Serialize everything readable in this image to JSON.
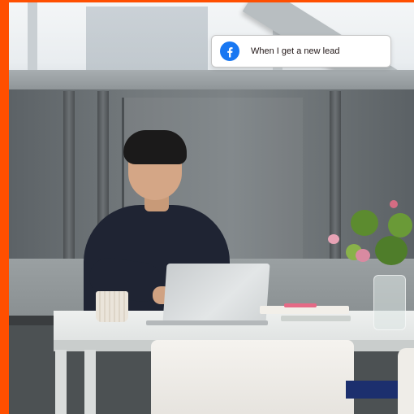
{
  "notification": {
    "app_icon": "facebook-icon",
    "text": "When I get a new lead"
  },
  "colors": {
    "accent_bar": "#ff4f00",
    "facebook_blue": "#1877f2",
    "card_bg": "#ffffff",
    "card_border": "#c7c7c7",
    "text": "#201515"
  }
}
